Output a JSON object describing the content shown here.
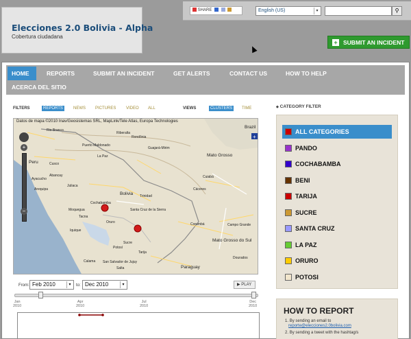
{
  "site": {
    "title": "Elecciones 2.0 Bolivia - Alpha",
    "tagline": "Cobertura ciudadana"
  },
  "top_bar": {
    "share_label": "SHARE",
    "language": "English (US)",
    "search_placeholder": "",
    "search_icon": "magnifier-icon"
  },
  "submit_button_label": "SUBMIT AN INCIDENT",
  "nav": {
    "items": [
      {
        "label": "HOME",
        "active": true
      },
      {
        "label": "REPORTS"
      },
      {
        "label": "SUBMIT AN INCIDENT"
      },
      {
        "label": "GET ALERTS"
      },
      {
        "label": "CONTACT US"
      },
      {
        "label": "HOW TO HELP"
      },
      {
        "label": "ACERCA DEL SITIO"
      }
    ]
  },
  "filters": {
    "label": "FILTERS",
    "tabs": [
      "REPORTS",
      "NEWS",
      "PICTURES",
      "VIDEO",
      "ALL"
    ],
    "active_tab": "REPORTS"
  },
  "views": {
    "label": "VIEWS",
    "tabs": [
      "CLUSTERS",
      "TIME"
    ],
    "active_tab": "CLUSTERS"
  },
  "map": {
    "attribution": "Datos de mapa ©2010 Inav/Geosistemas SRL, MapLink/Tele Atlas, Europa Technologies",
    "places": [
      "Brazil",
      "Peru",
      "Bolivia",
      "Paraguay",
      "La Paz",
      "Cusco",
      "Arequipa",
      "Juliaca",
      "Moquegua",
      "Tacna",
      "Oruro",
      "Sucre",
      "Potosí",
      "Cochabamba",
      "Santa Cruz de la Sierra",
      "Trinidad",
      "Rondônia",
      "Mato Grosso",
      "Cuiabá",
      "Corumbá",
      "Campo Grande",
      "Mato Grosso do Sul",
      "Iquique",
      "Calama",
      "Tarija",
      "Salta",
      "San Salvador de Jujuy",
      "Rio Branco",
      "Abancay",
      "Ayacucho",
      "Puerto Maldonado",
      "Riberalta",
      "Guajará-Mirim",
      "Cáceres",
      "Dourados"
    ],
    "incident_markers": 2
  },
  "timeline": {
    "from_label": "From:",
    "from_value": "Feb 2010",
    "to_label": "to:",
    "to_value": "Dec 2010",
    "play_label": "PLAY",
    "months": [
      {
        "month": "Jan",
        "year": "2010"
      },
      {
        "month": "Apr",
        "year": "2010"
      },
      {
        "month": "Jul",
        "year": "2010"
      },
      {
        "month": "Dec",
        "year": "2010"
      }
    ]
  },
  "category_filter": {
    "title": "CATEGORY FILTER",
    "items": [
      {
        "label": "ALL CATEGORIES",
        "color": "#cc0000",
        "active": true
      },
      {
        "label": "PANDO",
        "color": "#9933cc"
      },
      {
        "label": "COCHABAMBA",
        "color": "#3300cc"
      },
      {
        "label": "BENI",
        "color": "#663300"
      },
      {
        "label": "TARIJA",
        "color": "#cc0000"
      },
      {
        "label": "SUCRE",
        "color": "#cc9933"
      },
      {
        "label": "SANTA CRUZ",
        "color": "#9999ff"
      },
      {
        "label": "LA PAZ",
        "color": "#66cc33"
      },
      {
        "label": "ORURO",
        "color": "#ffcc00"
      },
      {
        "label": "POTOSI",
        "color": "#f2e6cc"
      }
    ]
  },
  "how_to_report": {
    "title": "HOW TO REPORT",
    "items": [
      {
        "number": "1.",
        "text": "By sending an email to",
        "link": "reporte@elecciones2.0bolivia.com"
      },
      {
        "number": "2.",
        "text": "By sending a tweet with the hashtag/s"
      }
    ]
  }
}
